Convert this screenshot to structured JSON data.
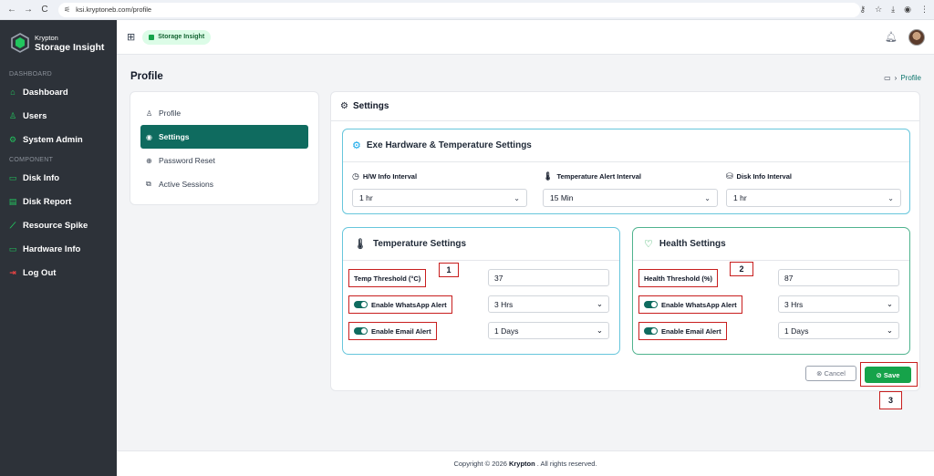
{
  "browser": {
    "url": "ksi.kryptoneb.com/profile",
    "back_icon": "←",
    "forward_icon": "→",
    "reload_icon": "C"
  },
  "brand": {
    "line1": "Krypton",
    "line2": "Storage Insight"
  },
  "sidebar": {
    "sections": [
      {
        "title": "DASHBOARD",
        "items": [
          {
            "label": "Dashboard",
            "icon": "⌂"
          },
          {
            "label": "Users",
            "icon": "♙"
          },
          {
            "label": "System Admin",
            "icon": "⚙"
          }
        ]
      },
      {
        "title": "COMPONENT",
        "items": [
          {
            "label": "Disk Info",
            "icon": "▭"
          },
          {
            "label": "Disk Report",
            "icon": "▤"
          },
          {
            "label": "Resource Spike",
            "icon": "⟋"
          },
          {
            "label": "Hardware Info",
            "icon": "▭"
          },
          {
            "label": "Log Out",
            "icon": "⇥"
          }
        ]
      }
    ]
  },
  "header": {
    "pill": "Storage Insight"
  },
  "page": {
    "title": "Profile",
    "breadcrumb_current": "Profile"
  },
  "profile_menu": [
    {
      "label": "Profile",
      "icon": "♙"
    },
    {
      "label": "Settings",
      "icon": "◉"
    },
    {
      "label": "Password Reset",
      "icon": "⊕"
    },
    {
      "label": "Active Sessions",
      "icon": "⧉"
    }
  ],
  "settings": {
    "title": "Settings",
    "hw": {
      "title": "Exe Hardware & Temperature Settings",
      "fields": [
        {
          "label": "H/W Info Interval",
          "value": "1 hr"
        },
        {
          "label": "Temperature Alert Interval",
          "value": "15 Min"
        },
        {
          "label": "Disk Info Interval",
          "value": "1 hr"
        }
      ]
    },
    "temperature": {
      "title": "Temperature Settings",
      "threshold_label": "Temp Threshold (°C)",
      "threshold_value": "37",
      "whatsapp_label": "Enable WhatsApp Alert",
      "whatsapp_value": "3 Hrs",
      "email_label": "Enable Email Alert",
      "email_value": "1 Days"
    },
    "health": {
      "title": "Health Settings",
      "threshold_label": "Health Threshold (%)",
      "threshold_value": "87",
      "whatsapp_label": "Enable WhatsApp Alert",
      "whatsapp_value": "3 Hrs",
      "email_label": "Enable Email Alert",
      "email_value": "1 Days"
    },
    "cancel_label": "Cancel",
    "save_label": "Save"
  },
  "markers": [
    "1",
    "2",
    "3"
  ],
  "footer": {
    "prefix": "Copyright © 2026",
    "brand": "Krypton",
    "suffix": ". All rights reserved."
  }
}
